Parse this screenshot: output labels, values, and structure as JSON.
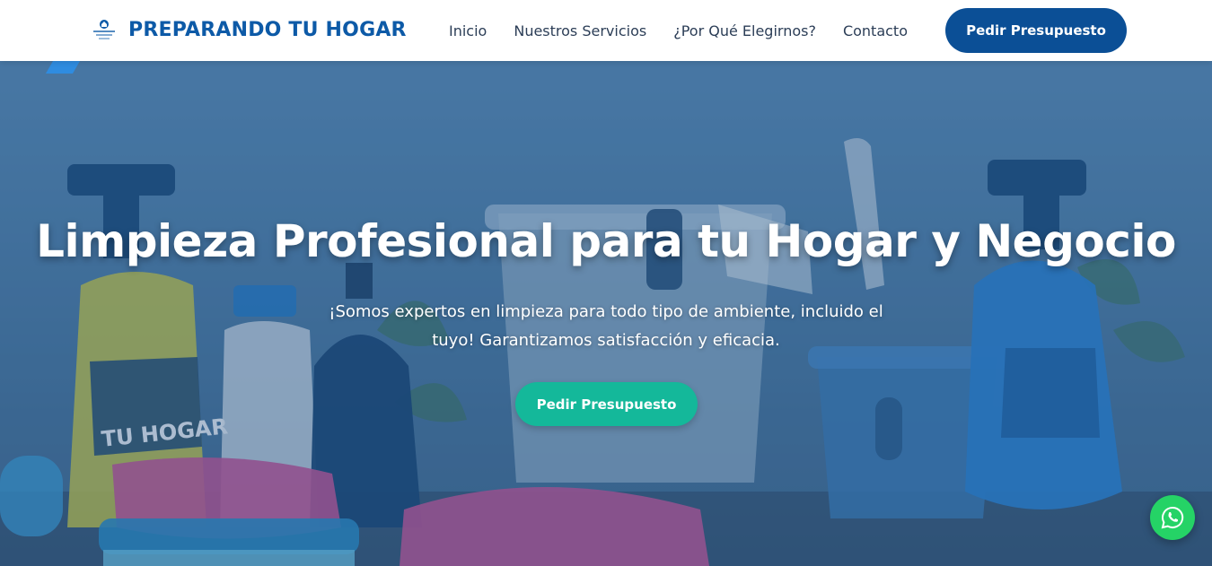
{
  "brand": {
    "name": "PREPARANDO TU HOGAR",
    "logo_text": "PREPARANDO TU HOGAR"
  },
  "nav": {
    "items": [
      {
        "label": "Inicio"
      },
      {
        "label": "Nuestros Servicios"
      },
      {
        "label": "¿Por Qué Elegirnos?"
      },
      {
        "label": "Contacto"
      }
    ],
    "cta_label": "Pedir Presupuesto"
  },
  "hero": {
    "title": "Limpieza Profesional para tu Hogar y Negocio",
    "subtitle": "¡Somos expertos en limpieza para todo tipo de ambiente, incluido el tuyo! Garantizamos satisfacción y eficacia.",
    "cta_label": "Pedir Presupuesto",
    "bottle_label": "TU HOGAR"
  },
  "floating": {
    "whatsapp_icon": "whatsapp-icon"
  },
  "colors": {
    "brand_blue": "#0d5aa7",
    "nav_cta": "#0b4f96",
    "hero_cta": "#14b89a",
    "whatsapp": "#25d366"
  }
}
